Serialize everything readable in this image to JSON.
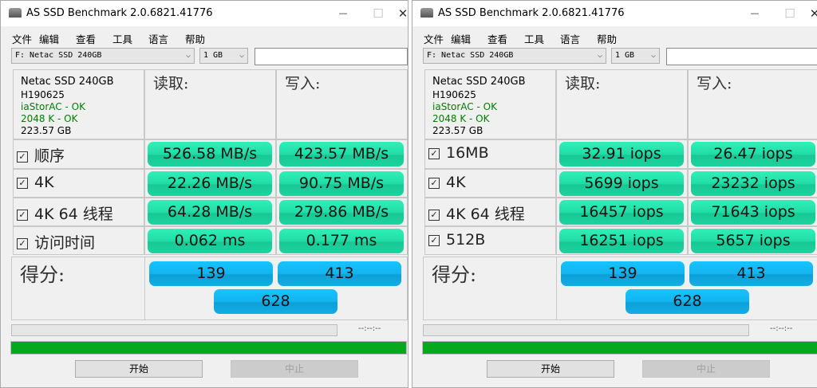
{
  "windows": [
    {
      "title": "AS SSD Benchmark 2.0.6821.41776",
      "menu": [
        "文件",
        "编辑",
        "查看",
        "工具",
        "语言",
        "帮助"
      ],
      "drive": "F: Netac SSD 240GB",
      "size": "1 GB",
      "textbox": "",
      "info": {
        "model": "Netac SSD 240GB",
        "firmware": "H190625",
        "driver": "iaStorAC - OK",
        "align": "2048 K - OK",
        "capacity": "223.57 GB"
      },
      "read_header": "读取:",
      "write_header": "写入:",
      "rows": [
        {
          "label": "顺序",
          "checked": true,
          "read": "526.58 MB/s",
          "write": "423.57 MB/s"
        },
        {
          "label": "4K",
          "checked": true,
          "read": "22.26 MB/s",
          "write": "90.75 MB/s"
        },
        {
          "label": "4K 64 线程",
          "checked": true,
          "read": "64.28 MB/s",
          "write": "279.86 MB/s"
        },
        {
          "label": "访问时间",
          "checked": true,
          "read": "0.062 ms",
          "write": "0.177 ms"
        }
      ],
      "score_label": "得分:",
      "score_read": "139",
      "score_write": "413",
      "score_total": "628",
      "time": "--:--:--",
      "progress": 1.0,
      "start": "开始",
      "stop": "中止"
    },
    {
      "title": "AS SSD Benchmark 2.0.6821.41776",
      "menu": [
        "文件",
        "编辑",
        "查看",
        "工具",
        "语言",
        "帮助"
      ],
      "drive": "F: Netac SSD 240GB",
      "size": "1 GB",
      "textbox": "",
      "info": {
        "model": "Netac SSD 240GB",
        "firmware": "H190625",
        "driver": "iaStorAC - OK",
        "align": "2048 K - OK",
        "capacity": "223.57 GB"
      },
      "read_header": "读取:",
      "write_header": "写入:",
      "rows": [
        {
          "label": "16MB",
          "checked": true,
          "read": "32.91 iops",
          "write": "26.47 iops"
        },
        {
          "label": "4K",
          "checked": true,
          "read": "5699 iops",
          "write": "23232 iops"
        },
        {
          "label": "4K 64 线程",
          "checked": true,
          "read": "16457 iops",
          "write": "71643 iops"
        },
        {
          "label": "512B",
          "checked": true,
          "read": "16251 iops",
          "write": "5657 iops"
        }
      ],
      "score_label": "得分:",
      "score_read": "139",
      "score_write": "413",
      "score_total": "628",
      "time": "--:--:--",
      "progress": 1.0,
      "start": "开始",
      "stop": "中止"
    }
  ]
}
